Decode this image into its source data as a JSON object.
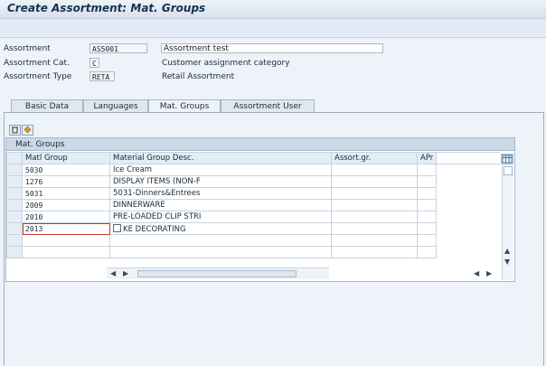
{
  "window": {
    "title": "Create Assortment: Mat. Groups"
  },
  "header_fields": {
    "assortment": {
      "label": "Assortment",
      "value": "AS5001",
      "description": "Assortment test"
    },
    "assortment_cat": {
      "label": "Assortment Cat.",
      "value": "C",
      "description": "Customer assignment category"
    },
    "assortment_type": {
      "label": "Assortment Type",
      "value": "RETA",
      "description": "Retail Assortment"
    }
  },
  "tabs": [
    {
      "label": "Basic Data",
      "active": false
    },
    {
      "label": "Languages",
      "active": false
    },
    {
      "label": "Mat. Groups",
      "active": true
    },
    {
      "label": "Assortment User",
      "active": false
    }
  ],
  "grid": {
    "title": "Mat. Groups",
    "columns": [
      "Matl Group",
      "Material Group Desc.",
      "Assort.gr.",
      "APr"
    ],
    "rows": [
      {
        "matl_group": "5030",
        "desc": "Ice Cream",
        "assort_gr": "",
        "apr": ""
      },
      {
        "matl_group": "1276",
        "desc": "DISPLAY ITEMS (NON-F",
        "assort_gr": "",
        "apr": ""
      },
      {
        "matl_group": "5031",
        "desc": "5031-Dinners&Entrees",
        "assort_gr": "",
        "apr": ""
      },
      {
        "matl_group": "2009",
        "desc": "DINNERWARE",
        "assort_gr": "",
        "apr": ""
      },
      {
        "matl_group": "2010",
        "desc": "PRE-LOADED CLIP STRI",
        "assort_gr": "",
        "apr": ""
      },
      {
        "matl_group": "2013",
        "desc": "KE DECORATING",
        "assort_gr": "",
        "apr": ""
      }
    ]
  },
  "icons": {
    "delete": "trash-icon",
    "insert": "insert-row-icon",
    "layout": "table-settings-icon"
  }
}
